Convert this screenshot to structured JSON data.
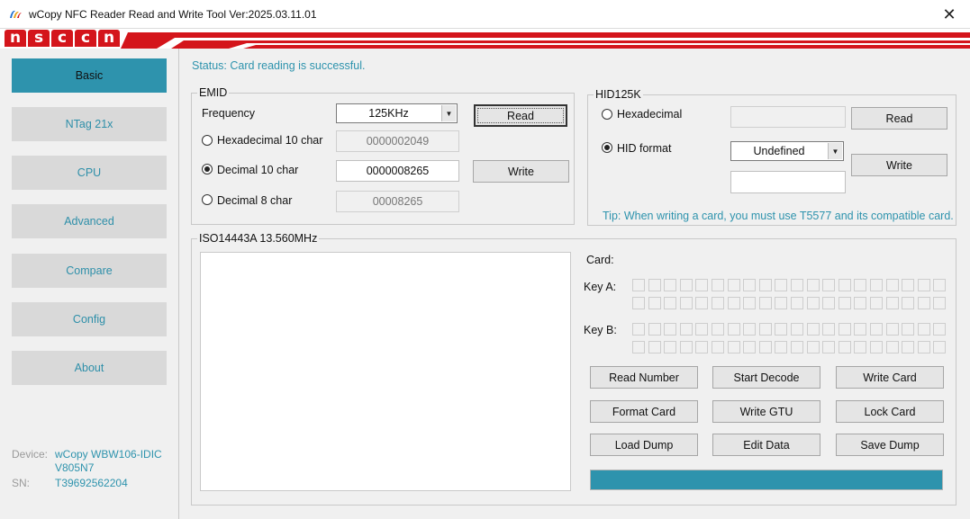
{
  "window": {
    "title": "wCopy NFC Reader Read and Write Tool  Ver:2025.03.11.01",
    "close_glyph": "✕",
    "accent_color": "#2e93ad"
  },
  "logo": {
    "letters": [
      "n",
      "s",
      "c",
      "c",
      "n"
    ]
  },
  "sidebar": {
    "items": [
      {
        "label": "Basic",
        "active": true
      },
      {
        "label": "NTag 21x",
        "active": false
      },
      {
        "label": "CPU",
        "active": false
      },
      {
        "label": "Advanced",
        "active": false
      },
      {
        "label": "Compare",
        "active": false
      },
      {
        "label": "Config",
        "active": false
      },
      {
        "label": "About",
        "active": false
      }
    ],
    "device_label": "Device:",
    "device_value_line1": "wCopy WBW106-IDIC",
    "device_value_line2": "V805N7",
    "sn_label": "SN:",
    "sn_value": "T39692562204"
  },
  "status": "Status: Card reading is successful.",
  "emid": {
    "legend": "EMID",
    "frequency_label": "Frequency",
    "frequency_value": "125KHz",
    "read_label": "Read",
    "write_label": "Write",
    "hex10_label": "Hexadecimal 10 char",
    "hex10_value": "0000002049",
    "dec10_label": "Decimal 10 char",
    "dec10_value": "0000008265",
    "dec8_label": "Decimal 8 char",
    "dec8_value": "00008265",
    "selected_format": "dec10"
  },
  "hid": {
    "legend": "HID125K",
    "hex_label": "Hexadecimal",
    "hex_value": "",
    "format_label": "HID format",
    "format_value": "Undefined",
    "format_input_value": "",
    "read_label": "Read",
    "write_label": "Write",
    "selected": "hid_format",
    "tip": "Tip: When writing a card, you must use T5577 and its compatible card."
  },
  "iso": {
    "legend": "ISO14443A 13.560MHz",
    "log_text": "",
    "card_label": "Card:",
    "key_a_label": "Key A:",
    "key_b_label": "Key B:",
    "buttons": [
      "Read Number",
      "Start Decode",
      "Write Card",
      "Format Card",
      "Write GTU",
      "Lock Card",
      "Load Dump",
      "Edit Data",
      "Save Dump"
    ],
    "progress_fraction": 1.0
  }
}
